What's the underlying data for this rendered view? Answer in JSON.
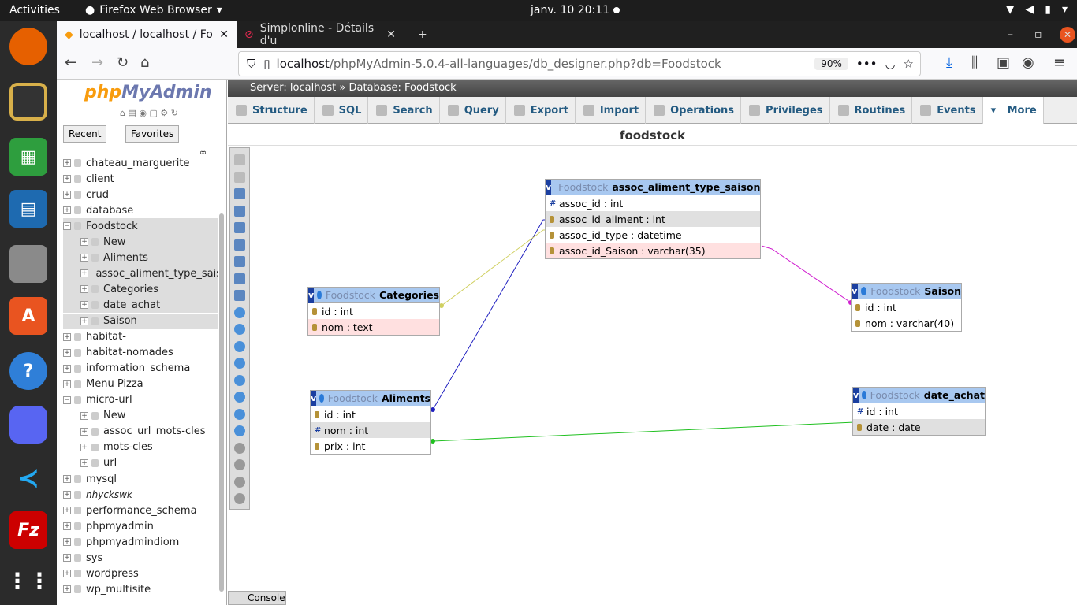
{
  "topbar": {
    "activities": "Activities",
    "app": "Firefox Web Browser",
    "clock": "janv. 10  20:11"
  },
  "tabs": [
    {
      "title": "localhost / localhost / Fo"
    },
    {
      "title": "Simplonline - Détails d'u"
    }
  ],
  "url": {
    "host": "localhost",
    "path": "/phpMyAdmin-5.0.4-all-languages/db_designer.php?db=Foodstock",
    "zoom": "90%"
  },
  "sidebar": {
    "logo_a": "php",
    "logo_b": "MyAdmin",
    "recent": "Recent",
    "favorites": "Favorites",
    "items": [
      {
        "label": "chateau_marguerite",
        "lvl": 0
      },
      {
        "label": "client",
        "lvl": 0
      },
      {
        "label": "crud",
        "lvl": 0
      },
      {
        "label": "database",
        "lvl": 0
      },
      {
        "label": "Foodstock",
        "lvl": 0,
        "sel": true
      },
      {
        "label": "New",
        "lvl": 1,
        "sel": true
      },
      {
        "label": "Aliments",
        "lvl": 1,
        "sel": true
      },
      {
        "label": "assoc_aliment_type_saison",
        "lvl": 1,
        "sel": true
      },
      {
        "label": "Categories",
        "lvl": 1,
        "sel": true
      },
      {
        "label": "date_achat",
        "lvl": 1,
        "sel": true
      },
      {
        "label": "Saison",
        "lvl": 1,
        "sel": true
      },
      {
        "label": "habitat-",
        "lvl": 0
      },
      {
        "label": "habitat-nomades",
        "lvl": 0
      },
      {
        "label": "information_schema",
        "lvl": 0
      },
      {
        "label": "Menu Pizza",
        "lvl": 0
      },
      {
        "label": "micro-url",
        "lvl": 0
      },
      {
        "label": "New",
        "lvl": 1
      },
      {
        "label": "assoc_url_mots-cles",
        "lvl": 1
      },
      {
        "label": "mots-cles",
        "lvl": 1
      },
      {
        "label": "url",
        "lvl": 1
      },
      {
        "label": "mysql",
        "lvl": 0
      },
      {
        "label": "nhyckswk",
        "lvl": 0,
        "italic": true
      },
      {
        "label": "performance_schema",
        "lvl": 0
      },
      {
        "label": "phpmyadmin",
        "lvl": 0
      },
      {
        "label": "phpmyadmindiom",
        "lvl": 0
      },
      {
        "label": "sys",
        "lvl": 0
      },
      {
        "label": "wordpress",
        "lvl": 0
      },
      {
        "label": "wp_multisite",
        "lvl": 0
      }
    ]
  },
  "crumb": {
    "server": "Server: localhost",
    "db": "Database: Foodstock"
  },
  "menu": [
    "Structure",
    "SQL",
    "Search",
    "Query",
    "Export",
    "Import",
    "Operations",
    "Privileges",
    "Routines",
    "Events",
    "More"
  ],
  "db_title": "foodstock",
  "console": "Console",
  "tables": [
    {
      "schema": "Foodstock",
      "name": "assoc_aliment_type_saison",
      "cols": [
        {
          "t": "assoc_id : int",
          "k": "h"
        },
        {
          "t": "assoc_id_aliment : int",
          "k": "k",
          "bg": "alt"
        },
        {
          "t": "assoc_id_type : datetime",
          "k": "k"
        },
        {
          "t": "assoc_id_Saison : varchar(35)",
          "k": "k",
          "bg": "red"
        }
      ]
    },
    {
      "schema": "Foodstock",
      "name": "Categories",
      "cols": [
        {
          "t": "id : int",
          "k": "k"
        },
        {
          "t": "nom : text",
          "k": "k",
          "bg": "red"
        }
      ]
    },
    {
      "schema": "Foodstock",
      "name": "Saison",
      "cols": [
        {
          "t": "id : int",
          "k": "k"
        },
        {
          "t": "nom : varchar(40)",
          "k": "k"
        }
      ]
    },
    {
      "schema": "Foodstock",
      "name": "Aliments",
      "cols": [
        {
          "t": "id : int",
          "k": "k"
        },
        {
          "t": "nom : int",
          "k": "h",
          "bg": "alt"
        },
        {
          "t": "prix : int",
          "k": "k"
        }
      ]
    },
    {
      "schema": "Foodstock",
      "name": "date_achat",
      "cols": [
        {
          "t": "id : int",
          "k": "h"
        },
        {
          "t": "date : date",
          "k": "k",
          "bg": "alt"
        }
      ]
    }
  ],
  "colors": {
    "rel_blue": "#2020c0",
    "rel_yellow": "#d0d060",
    "rel_magenta": "#d020d0",
    "rel_green": "#20c020"
  }
}
